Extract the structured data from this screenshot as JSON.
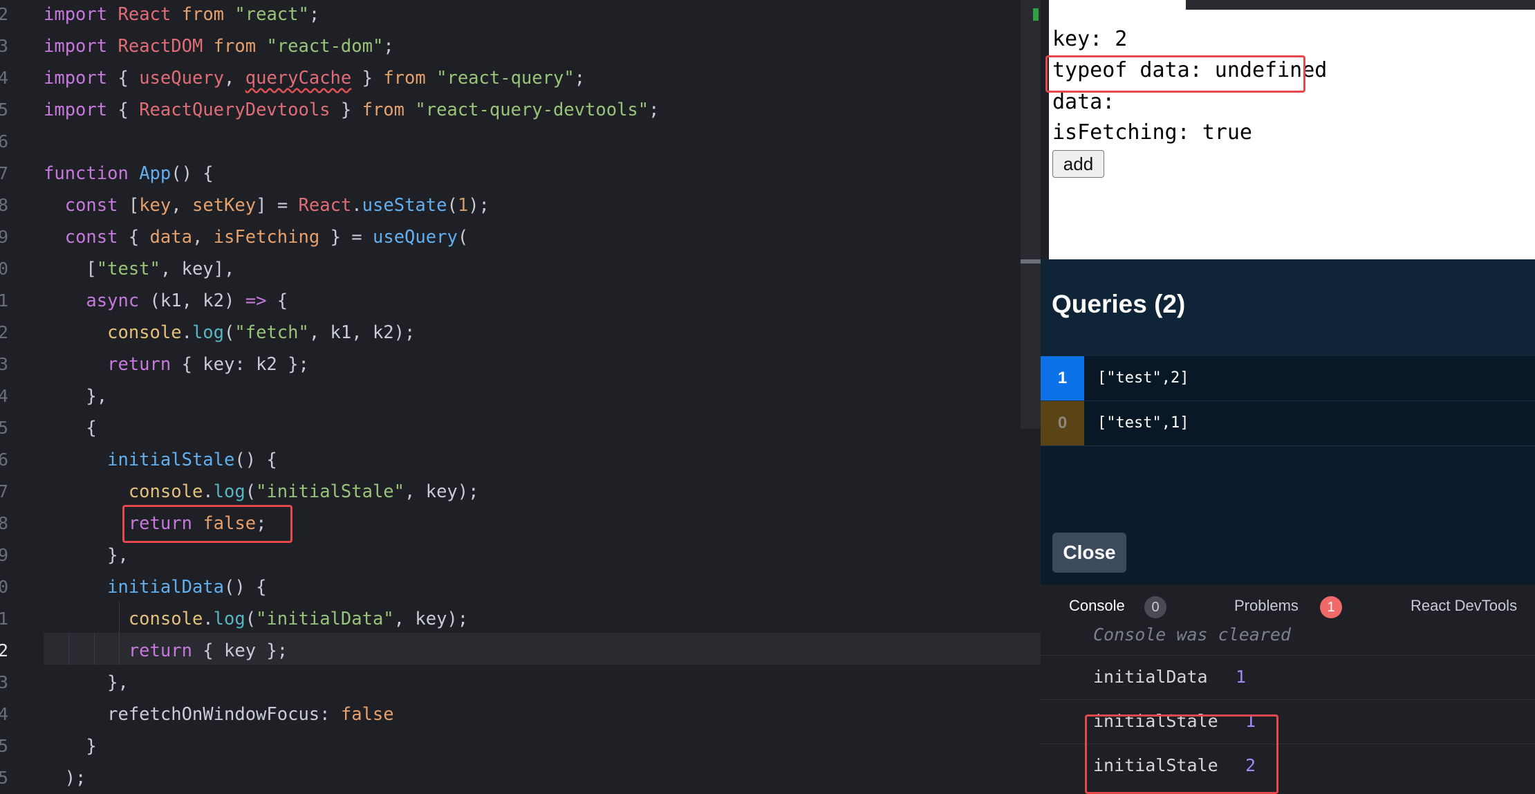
{
  "editor": {
    "line_numbers": [
      "2",
      "3",
      "4",
      "5",
      "6",
      "7",
      "8",
      "9",
      "0",
      "1",
      "2",
      "3",
      "4",
      "5",
      "6",
      "7",
      "8",
      "9",
      "0",
      "1",
      "2",
      "3",
      "4",
      "5",
      "5"
    ],
    "lines": [
      [
        [
          "k",
          "import"
        ],
        [
          "p",
          " "
        ],
        [
          "r",
          "React"
        ],
        [
          "p",
          " "
        ],
        [
          "kf",
          "from"
        ],
        [
          "p",
          " "
        ],
        [
          "s",
          "\"react\""
        ],
        [
          "p",
          ";"
        ]
      ],
      [
        [
          "k",
          "import"
        ],
        [
          "p",
          " "
        ],
        [
          "r",
          "ReactDOM"
        ],
        [
          "p",
          " "
        ],
        [
          "kf",
          "from"
        ],
        [
          "p",
          " "
        ],
        [
          "s",
          "\"react-dom\""
        ],
        [
          "p",
          ";"
        ]
      ],
      [
        [
          "k",
          "import"
        ],
        [
          "p",
          " { "
        ],
        [
          "r",
          "useQuery"
        ],
        [
          "p",
          ", "
        ],
        [
          "warn",
          "queryCache"
        ],
        [
          "p",
          " } "
        ],
        [
          "kf",
          "from"
        ],
        [
          "p",
          " "
        ],
        [
          "s",
          "\"react-query\""
        ],
        [
          "p",
          ";"
        ]
      ],
      [
        [
          "k",
          "import"
        ],
        [
          "p",
          " { "
        ],
        [
          "r",
          "ReactQueryDevtools"
        ],
        [
          "p",
          " } "
        ],
        [
          "kf",
          "from"
        ],
        [
          "p",
          " "
        ],
        [
          "s",
          "\"react-query-devtools\""
        ],
        [
          "p",
          ";"
        ]
      ],
      [],
      [
        [
          "k",
          "function"
        ],
        [
          "p",
          " "
        ],
        [
          "f",
          "App"
        ],
        [
          "p",
          "() {"
        ]
      ],
      [
        [
          "p",
          "  "
        ],
        [
          "k",
          "const"
        ],
        [
          "p",
          " ["
        ],
        [
          "v",
          "key"
        ],
        [
          "p",
          ", "
        ],
        [
          "v",
          "setKey"
        ],
        [
          "p",
          "] = "
        ],
        [
          "r",
          "React"
        ],
        [
          "p",
          "."
        ],
        [
          "f",
          "useState"
        ],
        [
          "p",
          "("
        ],
        [
          "n",
          "1"
        ],
        [
          "p",
          ");"
        ]
      ],
      [
        [
          "p",
          "  "
        ],
        [
          "k",
          "const"
        ],
        [
          "p",
          " { "
        ],
        [
          "v",
          "data"
        ],
        [
          "p",
          ", "
        ],
        [
          "v",
          "isFetching"
        ],
        [
          "p",
          " } = "
        ],
        [
          "f",
          "useQuery"
        ],
        [
          "p",
          "("
        ]
      ],
      [
        [
          "p",
          "    ["
        ],
        [
          "s",
          "\"test\""
        ],
        [
          "p",
          ", key],"
        ]
      ],
      [
        [
          "p",
          "    "
        ],
        [
          "k",
          "async"
        ],
        [
          "p",
          " (k1, k2) "
        ],
        [
          "k",
          "=>"
        ],
        [
          "p",
          " {"
        ]
      ],
      [
        [
          "p",
          "      "
        ],
        [
          "y",
          "console"
        ],
        [
          "p",
          "."
        ],
        [
          "c",
          "log"
        ],
        [
          "p",
          "("
        ],
        [
          "s",
          "\"fetch\""
        ],
        [
          "p",
          ", k1, k2);"
        ]
      ],
      [
        [
          "p",
          "      "
        ],
        [
          "k",
          "return"
        ],
        [
          "p",
          " { key: k2 };"
        ]
      ],
      [
        [
          "p",
          "    },"
        ]
      ],
      [
        [
          "p",
          "    {"
        ]
      ],
      [
        [
          "p",
          "      "
        ],
        [
          "f",
          "initialStale"
        ],
        [
          "p",
          "() {"
        ]
      ],
      [
        [
          "p",
          "        "
        ],
        [
          "y",
          "console"
        ],
        [
          "p",
          "."
        ],
        [
          "c",
          "log"
        ],
        [
          "p",
          "("
        ],
        [
          "s",
          "\"initialStale\""
        ],
        [
          "p",
          ", key);"
        ]
      ],
      [
        [
          "p",
          "        "
        ],
        [
          "k",
          "return"
        ],
        [
          "p",
          " "
        ],
        [
          "kf",
          "false"
        ],
        [
          "p",
          ";"
        ]
      ],
      [
        [
          "p",
          "      },"
        ]
      ],
      [
        [
          "p",
          "      "
        ],
        [
          "f",
          "initialData"
        ],
        [
          "p",
          "() {"
        ]
      ],
      [
        [
          "p",
          "        "
        ],
        [
          "y",
          "console"
        ],
        [
          "p",
          "."
        ],
        [
          "c",
          "log"
        ],
        [
          "p",
          "("
        ],
        [
          "s",
          "\"initialData\""
        ],
        [
          "p",
          ", key);"
        ]
      ],
      [
        [
          "p",
          "        "
        ],
        [
          "k",
          "return"
        ],
        [
          "p",
          " { key };"
        ]
      ],
      [
        [
          "p",
          "      },"
        ]
      ],
      [
        [
          "p",
          "      refetchOnWindowFocus: "
        ],
        [
          "kf",
          "false"
        ]
      ],
      [
        [
          "p",
          "    }"
        ]
      ],
      [
        [
          "p",
          "  );"
        ]
      ]
    ]
  },
  "preview": {
    "key_line": "key: 2",
    "typeof_line": "typeof data: undefined",
    "data_line": "data:",
    "fetching_line": "isFetching: true",
    "add_label": "add"
  },
  "devtools": {
    "title": "Queries (2)",
    "queries": [
      {
        "count": "1",
        "key": "[\"test\",2]",
        "badge_bg": "#0b72e7",
        "badge_fg": "#ffffff"
      },
      {
        "count": "0",
        "key": "[\"test\",1]",
        "badge_bg": "#5a4416",
        "badge_fg": "#8a8a7a"
      }
    ],
    "close_label": "Close"
  },
  "console": {
    "tabs": [
      {
        "label": "Console",
        "badge": "0",
        "badge_bg": "#4a4b52",
        "badge_fg": "#c9ccd2",
        "color": "#ffffff"
      },
      {
        "label": "Problems",
        "badge": "1",
        "badge_bg": "#f06a6a",
        "badge_fg": "#ffffff",
        "color": "#c9ccd2"
      },
      {
        "label": "React DevTools",
        "color": "#c9ccd2"
      }
    ],
    "cleared": "Console was cleared",
    "logs": [
      {
        "msg": "initialData",
        "val": "1"
      },
      {
        "msg": "initialStale",
        "val": "1"
      },
      {
        "msg": "initialStale",
        "val": "2"
      }
    ]
  },
  "colors": {
    "highlight": "#e5484d"
  }
}
